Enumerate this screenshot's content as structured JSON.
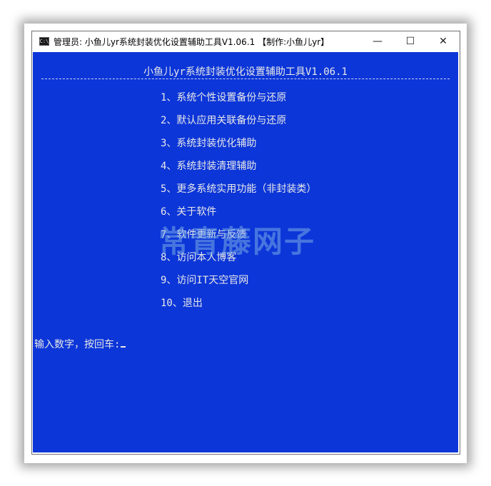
{
  "window": {
    "title": "管理员:  小鱼儿yr系统封装优化设置辅助工具V1.06.1 【制作:小鱼儿yr】",
    "icon_label": "C:\\",
    "controls": {
      "minimize": "—",
      "maximize": "☐",
      "close": "✕"
    }
  },
  "console": {
    "header": "小鱼儿yr系统封装优化设置辅助工具V1.06.1",
    "menu": [
      "1、系统个性设置备份与还原",
      "2、默认应用关联备份与还原",
      "3、系统封装优化辅助",
      "4、系统封装清理辅助",
      "5、更多系统实用功能（非封装类）",
      "6、关于软件",
      "7、软件更新与反馈",
      "8、访问本人博客",
      "9、访问IT天空官网",
      "10、退出"
    ],
    "prompt": "输入数字，按回车:"
  },
  "watermark": "常青藤网子",
  "colors": {
    "console_bg": "#0c36d8",
    "console_text": "#e8e8e8",
    "watermark": "#78aae6"
  }
}
